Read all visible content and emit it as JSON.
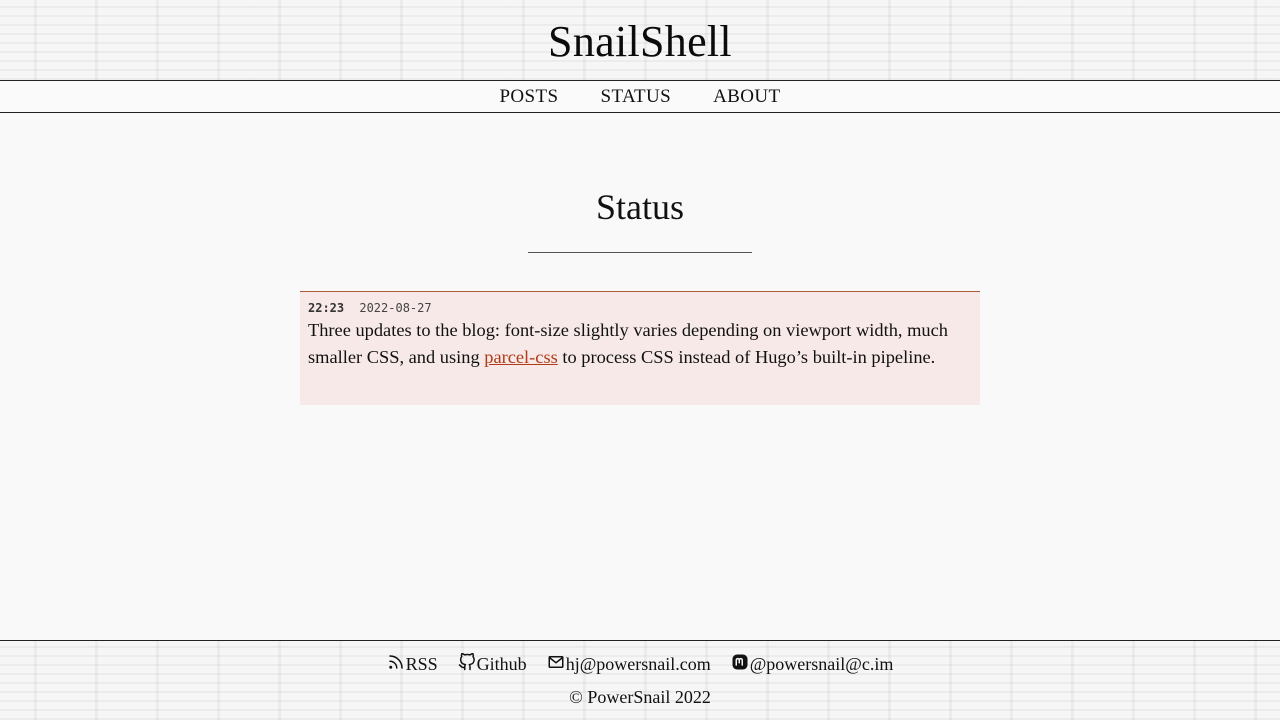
{
  "site": {
    "title": "SnailShell"
  },
  "nav": {
    "items": [
      "POSTS",
      "STATUS",
      "ABOUT"
    ]
  },
  "page": {
    "heading": "Status"
  },
  "status": {
    "time": "22:23",
    "date": "2022-08-27",
    "text_before": "Three updates to the blog: font-size slightly varies depending on viewport width, much smaller CSS, and using ",
    "link": "parcel-css",
    "text_after": " to process CSS instead of Hugo’s built-in pipeline."
  },
  "footer": {
    "links": [
      {
        "icon": "rss-icon",
        "label": "RSS"
      },
      {
        "icon": "github-icon",
        "label": "Github"
      },
      {
        "icon": "mail-icon",
        "label": "hj@powersnail.com"
      },
      {
        "icon": "mastodon-icon",
        "label": "@powersnail@c.im"
      }
    ],
    "copyright": "© PowerSnail 2022"
  }
}
